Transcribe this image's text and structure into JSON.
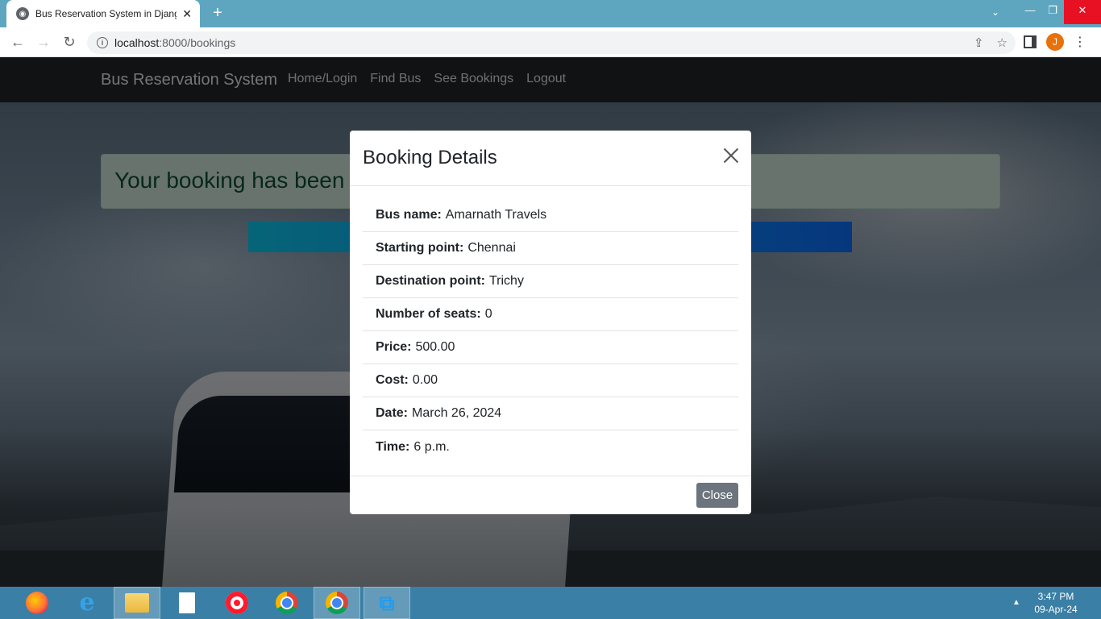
{
  "browser": {
    "tab_title": "Bus Reservation System in Djang",
    "new_tab_label": "+",
    "url_host": "localhost",
    "url_path": ":8000/bookings",
    "profile_initial": "J"
  },
  "navbar": {
    "brand": "Bus Reservation System",
    "links": [
      "Home/Login",
      "Find Bus",
      "See Bookings",
      "Logout"
    ]
  },
  "alert": {
    "text": "Your booking has been"
  },
  "modal": {
    "title": "Booking Details",
    "details": [
      {
        "label": "Bus name:",
        "value": "Amarnath Travels"
      },
      {
        "label": "Starting point:",
        "value": "Chennai"
      },
      {
        "label": "Destination point:",
        "value": "Trichy"
      },
      {
        "label": "Number of seats:",
        "value": "0"
      },
      {
        "label": "Price:",
        "value": "500.00"
      },
      {
        "label": "Cost:",
        "value": "0.00"
      },
      {
        "label": "Date:",
        "value": "March 26, 2024"
      },
      {
        "label": "Time:",
        "value": "6 p.m."
      }
    ],
    "close_button": "Close"
  },
  "taskbar": {
    "time": "3:47 PM",
    "date": "09-Apr-24"
  }
}
